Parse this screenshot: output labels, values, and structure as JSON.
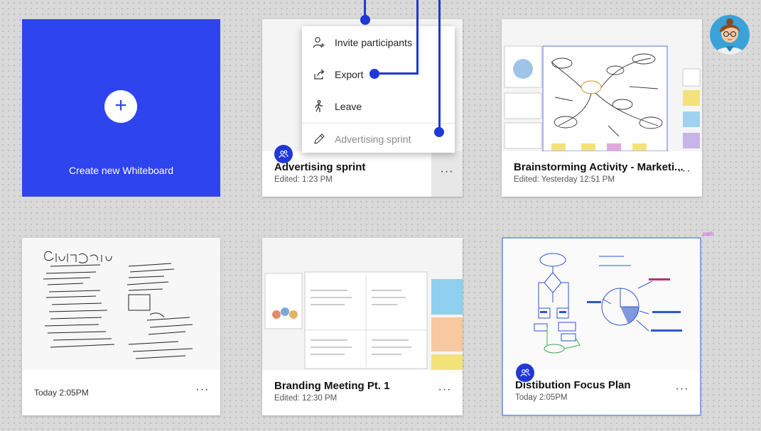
{
  "create_tile": {
    "label": "Create new Whiteboard",
    "icon": "plus-icon",
    "color": "#2e44ee"
  },
  "context_menu": {
    "items": [
      {
        "label": "Invite participants",
        "icon": "invite-person-icon"
      },
      {
        "label": "Export",
        "icon": "share-export-icon"
      },
      {
        "label": "Leave",
        "icon": "walk-leave-icon"
      },
      {
        "label": "Advertising sprint",
        "icon": "pencil-rename-icon"
      }
    ]
  },
  "boards": [
    {
      "title": "Advertising sprint",
      "subtitle": "Edited: 1:23 PM",
      "more": "···",
      "shared": true
    },
    {
      "title": "Brainstorming Activity - Marketi...",
      "subtitle": "Edited: Yesterday 12:51 PM",
      "more": "···",
      "shared": false
    },
    {
      "title": "",
      "subtitle": "Today 2:05PM",
      "more": "···",
      "shared": false
    },
    {
      "title": "Branding Meeting Pt. 1",
      "subtitle": "Edited: 12:30 PM",
      "more": "···",
      "shared": false
    },
    {
      "title": "Distibution Focus Plan",
      "subtitle": "Today 2:05PM",
      "more": "···",
      "shared": true
    }
  ],
  "annotation": {
    "path_label": "path",
    "accent": "#1f38d6"
  }
}
